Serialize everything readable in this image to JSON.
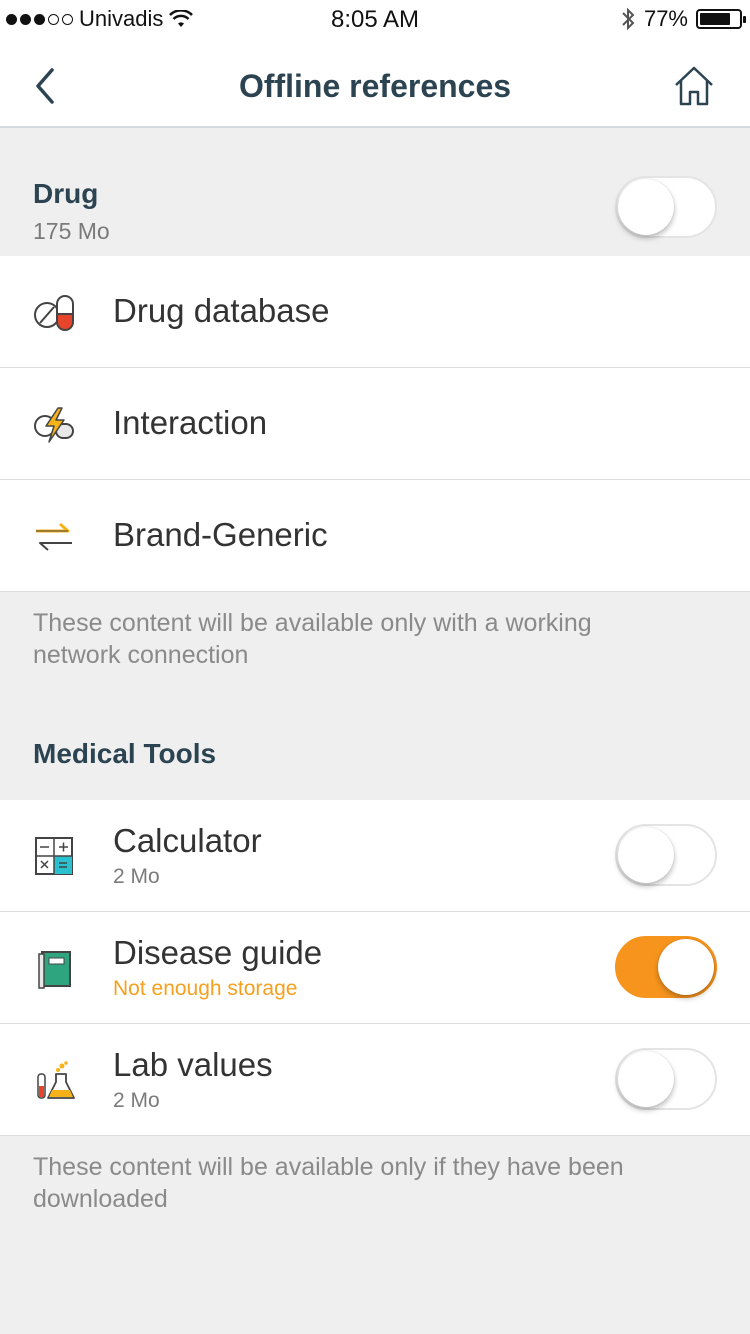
{
  "status_bar": {
    "carrier": "Univadis",
    "time": "8:05 AM",
    "battery": "77%"
  },
  "nav": {
    "title": "Offline references"
  },
  "drug_section": {
    "title": "Drug",
    "size": "175 Mo",
    "toggle_on": false,
    "items": [
      {
        "label": "Drug database",
        "icon": "pill-icon"
      },
      {
        "label": "Interaction",
        "icon": "interaction-icon"
      },
      {
        "label": "Brand-Generic",
        "icon": "swap-arrows-icon"
      }
    ],
    "note": "These content will be available only with a working network connection"
  },
  "tools_section": {
    "title": "Medical Tools",
    "items": [
      {
        "label": "Calculator",
        "sub": "2 Mo",
        "toggle_on": false,
        "icon": "calculator-icon"
      },
      {
        "label": "Disease guide",
        "sub": "Not enough storage",
        "toggle_on": true,
        "icon": "book-icon"
      },
      {
        "label": "Lab values",
        "sub": "2 Mo",
        "toggle_on": false,
        "icon": "lab-flask-icon"
      }
    ],
    "note": "These content will be available only if they have been downloaded"
  },
  "colors": {
    "accent": "#f7941d",
    "title": "#2c4452",
    "warning": "#f5a01f"
  }
}
